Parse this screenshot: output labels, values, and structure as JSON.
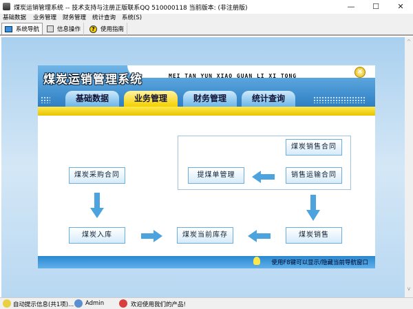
{
  "window": {
    "title": "煤炭运销管理系统 -- 技术支持与注册正版联系QQ 510000118    当前版本: (非注册版)",
    "controls": [
      "minimize",
      "maximize",
      "close"
    ]
  },
  "menu": [
    "基础数据",
    "业务管理",
    "财务管理",
    "统计查询",
    "系统(S)"
  ],
  "toolbar": [
    {
      "label": "系统导航",
      "icon": "monitor-icon",
      "active": true
    },
    {
      "label": "信息操作",
      "icon": "window-icon"
    },
    {
      "label": "使用指南",
      "icon": "help-icon"
    }
  ],
  "panel": {
    "brand": "煤炭运销管理系统",
    "pinyin": "MEI TAN YUN XIAO GUAN LI XI TONG",
    "tabs": [
      {
        "label": "基础数据"
      },
      {
        "label": "业务管理",
        "selected": true
      },
      {
        "label": "财务管理"
      },
      {
        "label": "统计查询"
      }
    ],
    "nodes": {
      "purchase": "煤炭采购合同",
      "stockin": "煤炭入库",
      "inventory": "煤炭当前库存",
      "sales": "煤炭销售",
      "pickup": "提煤单管理",
      "transport": "销售运输合同",
      "salescontract": "煤炭销售合同"
    },
    "footer_tip": "使用F8键可以显示/隐藏当前导航窗口"
  },
  "status": {
    "info": "自动提示信息(共1项)...",
    "user": "Admin",
    "welcome": "欢迎使用我们的产品!"
  },
  "colors": {
    "accent": "#2e7fc4",
    "tab_selected": "#f4d000",
    "arrow": "#4da3de"
  }
}
